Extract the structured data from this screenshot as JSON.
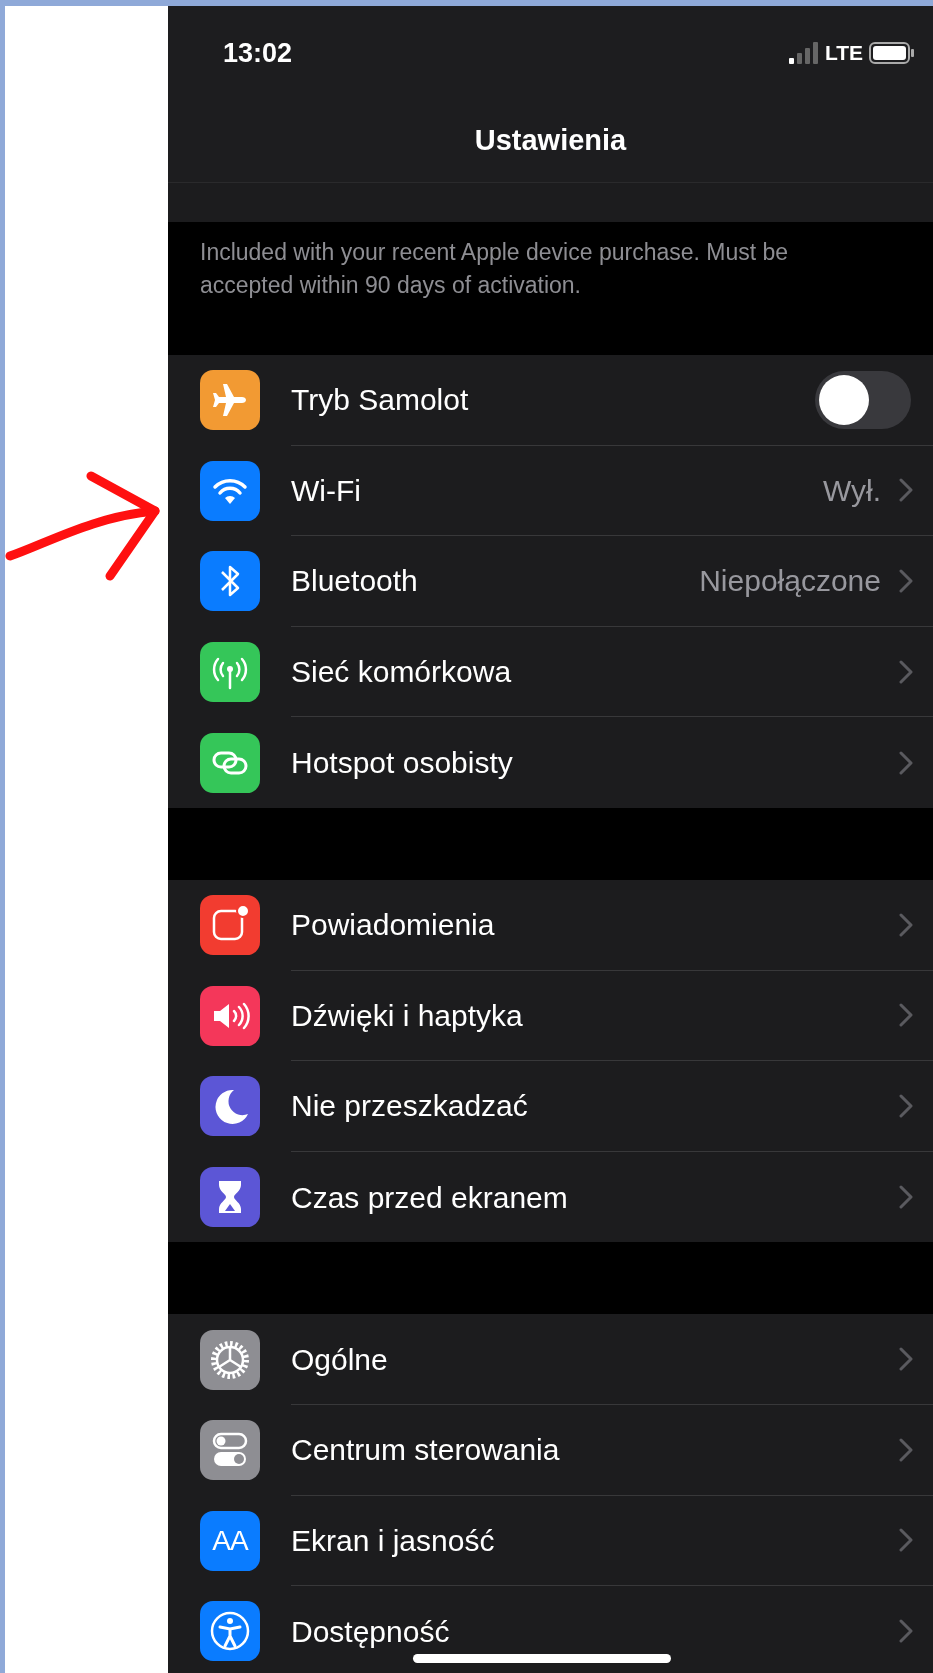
{
  "status_bar": {
    "time": "13:02",
    "network": "LTE"
  },
  "nav": {
    "title": "Ustawienia"
  },
  "footer_note": "Included with your recent Apple device purchase. Must be accepted within 90 days of activation.",
  "sections": [
    {
      "rows": [
        {
          "kind": "toggle",
          "label": "Tryb Samolot",
          "color": "#f29a33",
          "on": false
        },
        {
          "kind": "link",
          "label": "Wi-Fi",
          "color": "#0a7cff",
          "value": "Wył."
        },
        {
          "kind": "link",
          "label": "Bluetooth",
          "color": "#0a7cff",
          "value": "Niepołączone"
        },
        {
          "kind": "link",
          "label": "Sieć komórkowa",
          "color": "#35c659"
        },
        {
          "kind": "link",
          "label": "Hotspot osobisty",
          "color": "#35c659"
        }
      ]
    },
    {
      "rows": [
        {
          "kind": "link",
          "label": "Powiadomienia",
          "color": "#f23c30"
        },
        {
          "kind": "link",
          "label": "Dźwięki i haptyka",
          "color": "#f4375a"
        },
        {
          "kind": "link",
          "label": "Nie przeszkadzać",
          "color": "#5c56d6"
        },
        {
          "kind": "link",
          "label": "Czas przed ekranem",
          "color": "#5c56d6"
        }
      ]
    },
    {
      "rows": [
        {
          "kind": "link",
          "label": "Ogólne",
          "color": "#8e8e93"
        },
        {
          "kind": "link",
          "label": "Centrum sterowania",
          "color": "#8e8e93"
        },
        {
          "kind": "link",
          "label": "Ekran i jasność",
          "color": "#0a7cff",
          "icon_text": "AA"
        },
        {
          "kind": "link",
          "label": "Dostępność",
          "color": "#0a7cff"
        }
      ]
    }
  ]
}
